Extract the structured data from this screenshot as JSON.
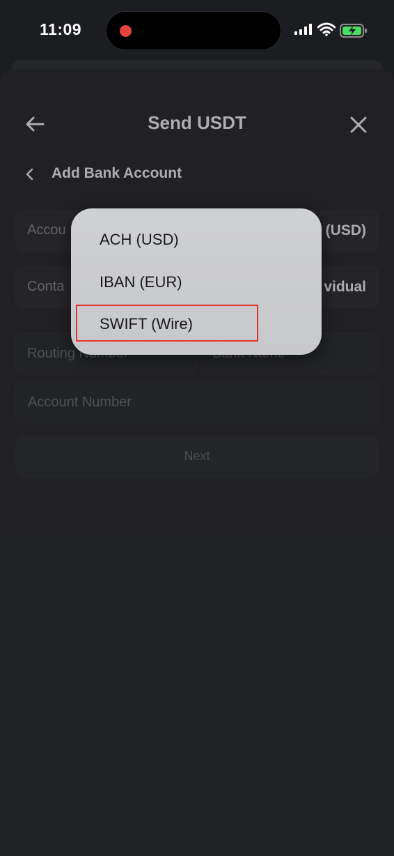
{
  "status_bar": {
    "time": "11:09",
    "icons": [
      "record-dot-icon",
      "cellular-signal-icon",
      "wifi-icon",
      "battery-charging-icon"
    ]
  },
  "header": {
    "title": "Send USDT",
    "back_icon": "arrow-left-icon",
    "close_icon": "close-icon"
  },
  "subheader": {
    "title": "Add Bank Account",
    "back_icon": "chevron-left-icon"
  },
  "form": {
    "account_type": {
      "label": "Accou",
      "value": "(USD)"
    },
    "contact_type": {
      "label": "Conta",
      "value": "vidual"
    },
    "routing_number": {
      "placeholder": "Routing Number"
    },
    "bank_name": {
      "placeholder": "Bank Name"
    },
    "account_number": {
      "placeholder": "Account Number"
    },
    "next_label": "Next"
  },
  "dropdown": {
    "options": [
      "ACH (USD)",
      "IBAN (EUR)",
      "SWIFT (Wire)"
    ],
    "highlighted_option": "SWIFT (Wire)"
  },
  "colors": {
    "background": "#1c1d20",
    "sheet": "#28292d",
    "highlight": "#e4332c",
    "menu": "#cfd0d3",
    "recording_dot": "#e5443d",
    "battery": "#4cd964"
  }
}
